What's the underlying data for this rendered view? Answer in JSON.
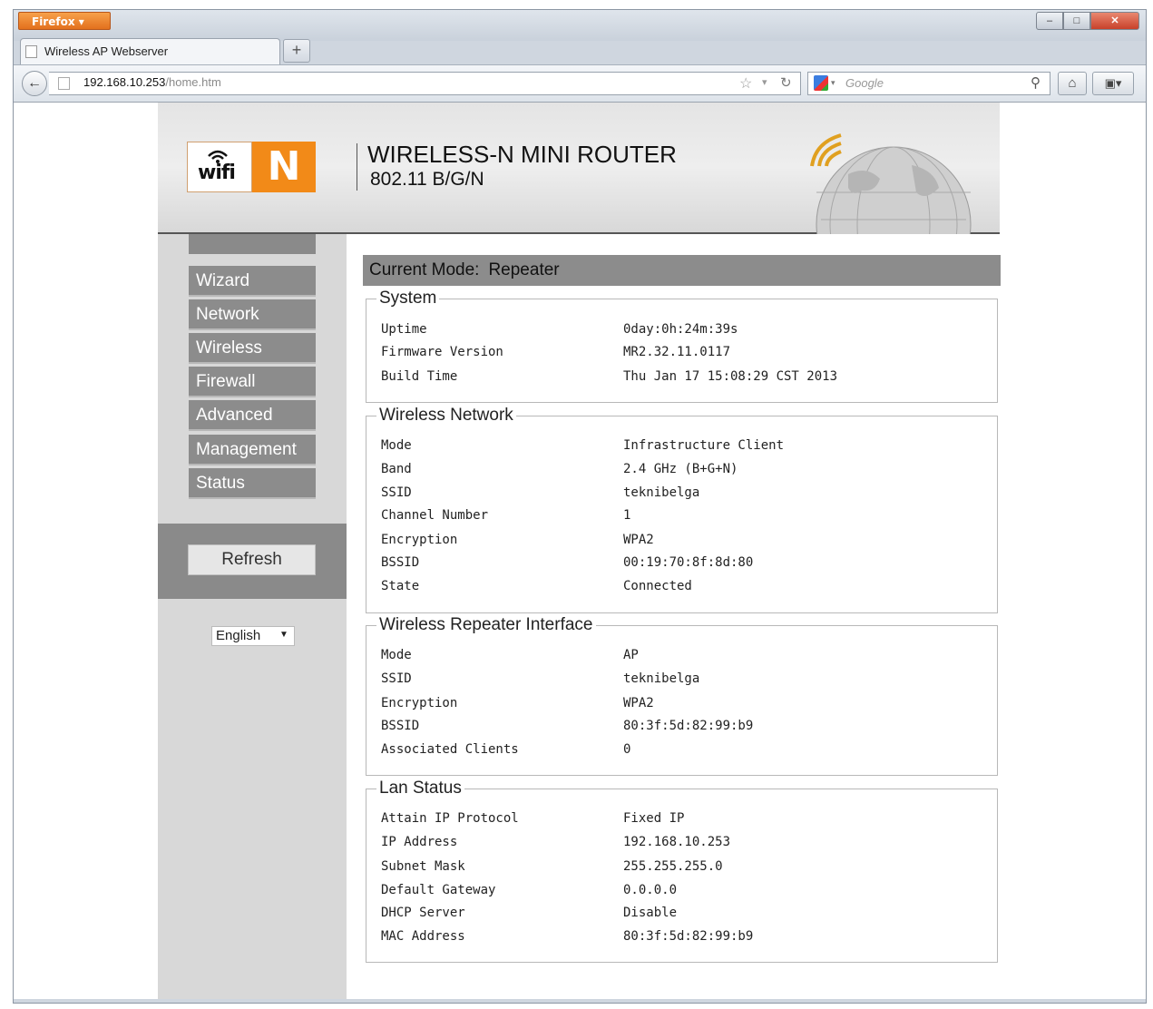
{
  "browser": {
    "app_button": "Firefox",
    "tab_title": "Wireless AP Webserver",
    "new_tab": "+",
    "url_host": "192.168.10.253",
    "url_path": "/home.htm",
    "search_placeholder": "Google"
  },
  "header": {
    "logo_wifi": "wifi",
    "logo_n": "N",
    "title": "WIRELESS-N MINI ROUTER",
    "subtitle": "802.11 B/G/N"
  },
  "sidebar": {
    "items": [
      {
        "label": "Wizard"
      },
      {
        "label": "Network"
      },
      {
        "label": "Wireless"
      },
      {
        "label": "Firewall"
      },
      {
        "label": "Advanced"
      },
      {
        "label": "Management"
      },
      {
        "label": "Status"
      }
    ],
    "refresh_label": "Refresh",
    "language": "English"
  },
  "main": {
    "mode_label": "Current Mode:",
    "mode_value": "Repeater",
    "sections": [
      {
        "title": "System",
        "rows": [
          {
            "label": "Uptime",
            "value": "0day:0h:24m:39s"
          },
          {
            "label": "Firmware Version",
            "value": "MR2.32.11.0117"
          },
          {
            "label": "Build Time",
            "value": "Thu Jan 17 15:08:29 CST 2013"
          }
        ]
      },
      {
        "title": "Wireless Network",
        "rows": [
          {
            "label": "Mode",
            "value": "Infrastructure Client"
          },
          {
            "label": "Band",
            "value": "2.4 GHz (B+G+N)"
          },
          {
            "label": "SSID",
            "value": "teknibelga"
          },
          {
            "label": "Channel Number",
            "value": "1"
          },
          {
            "label": "Encryption",
            "value": "WPA2"
          },
          {
            "label": "BSSID",
            "value": "00:19:70:8f:8d:80"
          },
          {
            "label": "State",
            "value": "Connected"
          }
        ]
      },
      {
        "title": "Wireless Repeater Interface",
        "rows": [
          {
            "label": "Mode",
            "value": "AP"
          },
          {
            "label": "SSID",
            "value": "teknibelga"
          },
          {
            "label": "Encryption",
            "value": "WPA2"
          },
          {
            "label": "BSSID",
            "value": "80:3f:5d:82:99:b9"
          },
          {
            "label": "Associated Clients",
            "value": "0"
          }
        ]
      },
      {
        "title": "Lan Status",
        "rows": [
          {
            "label": "Attain IP Protocol",
            "value": "Fixed IP"
          },
          {
            "label": "IP Address",
            "value": "192.168.10.253"
          },
          {
            "label": "Subnet Mask",
            "value": "255.255.255.0"
          },
          {
            "label": "Default Gateway",
            "value": "0.0.0.0"
          },
          {
            "label": "DHCP Server",
            "value": "Disable"
          },
          {
            "label": "MAC Address",
            "value": "80:3f:5d:82:99:b9"
          }
        ]
      }
    ]
  }
}
